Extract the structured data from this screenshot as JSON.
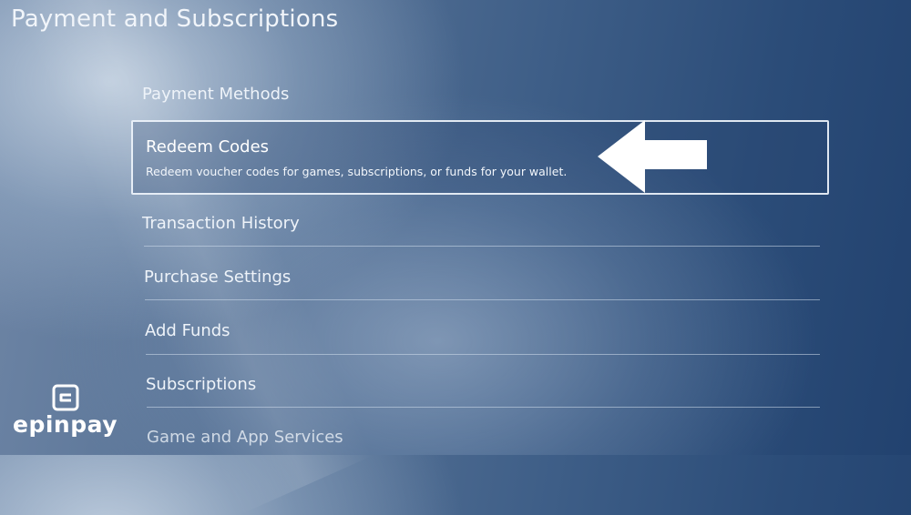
{
  "page": {
    "title": "Payment and Subscriptions"
  },
  "menu": {
    "items": [
      {
        "label": "Payment Methods"
      },
      {
        "label": "Redeem Codes",
        "description": "Redeem voucher codes for games, subscriptions, or funds for your wallet.",
        "selected": true
      },
      {
        "label": "Transaction History"
      },
      {
        "label": "Purchase Settings"
      },
      {
        "label": "Add Funds"
      },
      {
        "label": "Subscriptions"
      },
      {
        "label": "Game and App Services"
      }
    ]
  },
  "annotation": {
    "icon": "arrow-left-icon",
    "color": "#ffffff"
  },
  "brand": {
    "name": "epinpay",
    "icon": "epinpay-logo-icon"
  }
}
